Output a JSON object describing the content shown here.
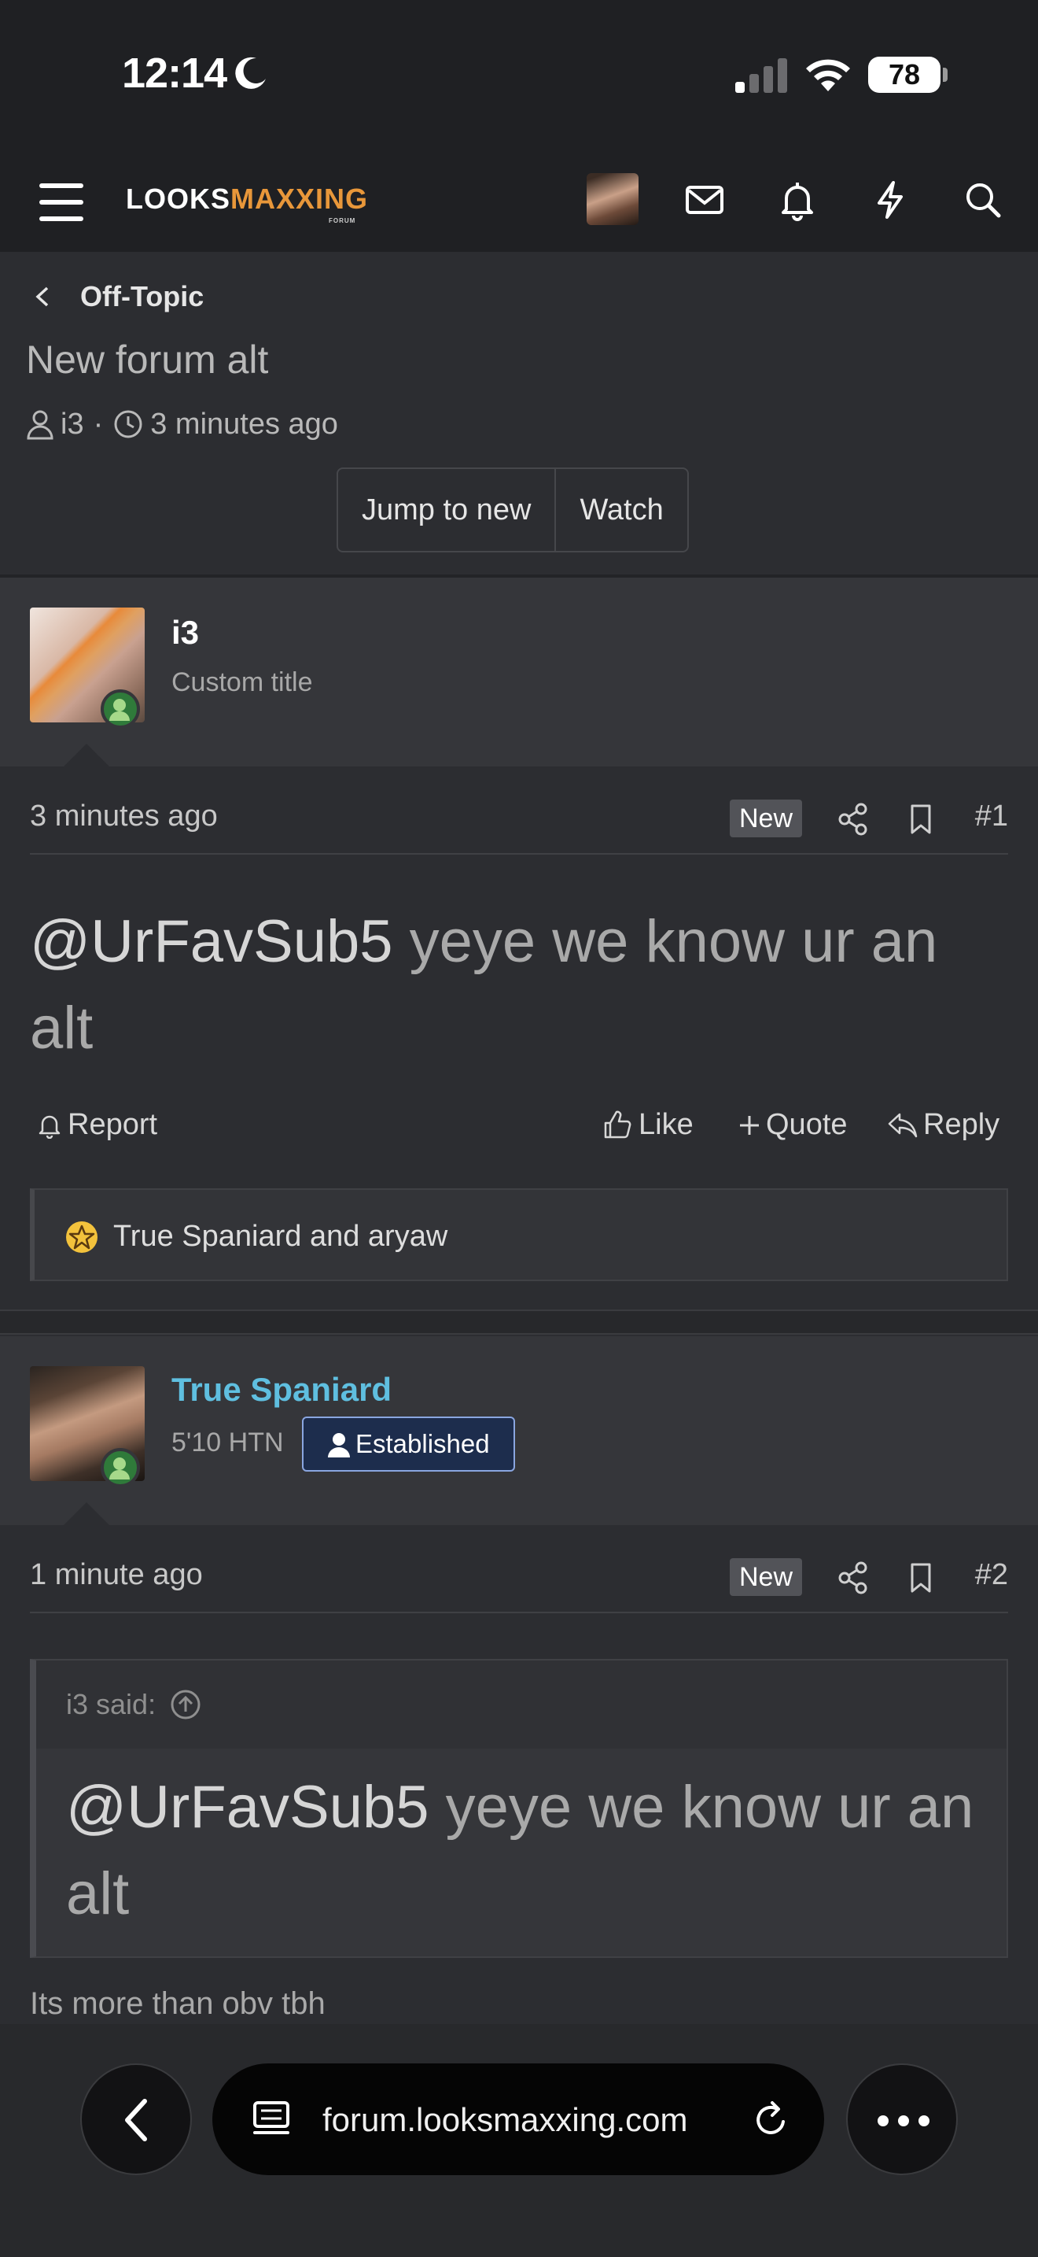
{
  "status_bar": {
    "time": "12:14",
    "battery": "78"
  },
  "header": {
    "logo_main": "LOOKS",
    "logo_accent": "MAXXING",
    "logo_sub": "FORUM"
  },
  "breadcrumb": {
    "label": "Off-Topic"
  },
  "thread": {
    "title": "New forum alt",
    "author": "i3",
    "time": "3 minutes ago",
    "separator": "·",
    "buttons": {
      "jump": "Jump to new",
      "watch": "Watch"
    }
  },
  "posts": [
    {
      "username": "i3",
      "user_title": "Custom title",
      "time": "3 minutes ago",
      "new_label": "New",
      "number": "#1",
      "mention": "@UrFavSub5",
      "text": " yeye we know ur an alt",
      "actions": {
        "report": "Report",
        "like": "Like",
        "quote": "Quote",
        "reply": "Reply"
      },
      "reactions": "True Spaniard and aryaw"
    },
    {
      "username": "True Spaniard",
      "user_title": "5'10 HTN",
      "badge": "Established",
      "time": "1 minute ago",
      "new_label": "New",
      "number": "#2",
      "quote_header": "i3 said:",
      "quote_mention": "@UrFavSub5",
      "quote_text": " yeye we know ur an alt",
      "text": "Its more than obv tbh"
    }
  ],
  "browser": {
    "url": "forum.looksmaxxing.com"
  },
  "colors": {
    "accent": "#e8973a",
    "username_link": "#5fbfe0",
    "online": "#2f7a3a"
  }
}
